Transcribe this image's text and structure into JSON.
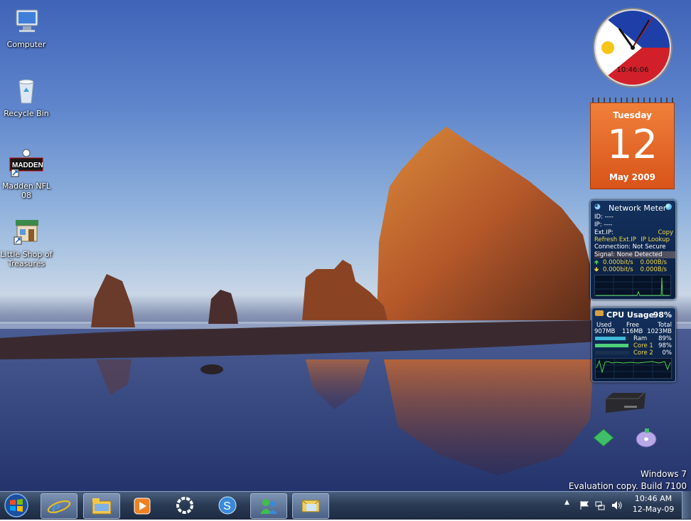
{
  "desktop_icons": [
    {
      "label": "Computer"
    },
    {
      "label": "Recycle Bin"
    },
    {
      "label": "Madden NFL 08",
      "art_text": "MADDEN"
    },
    {
      "label": "Little Shop of Treasures"
    }
  ],
  "watermark": {
    "line1": "Windows 7",
    "line2": "Evaluation copy. Build 7100"
  },
  "clock_gadget": {
    "time": "10:46:06"
  },
  "calendar_gadget": {
    "weekday": "Tuesday",
    "day": "12",
    "month_year": "May 2009"
  },
  "network_meter": {
    "title": "Network Meter",
    "id_label": "ID: ----",
    "ip_label": "IP: ----",
    "ext_ip_label": "Ext.IP:",
    "copy_link": "Copy",
    "refresh_link": "Refresh Ext.IP",
    "lookup_link": "IP Lookup",
    "connection": "Connection: Not Secure",
    "signal": "Signal: None Detected",
    "up_rate": "0.000bit/s",
    "up_bytes": "0.000B/s",
    "down_rate": "0.000bit/s",
    "down_bytes": "0.000B/s"
  },
  "cpu_gadget": {
    "title": "CPU Usage",
    "percent": "98%",
    "used_label": "Used",
    "free_label": "Free",
    "total_label": "Total",
    "used": "907MB",
    "free": "116MB",
    "total": "1023MB",
    "ram_label": "Ram",
    "ram_pct": "89%",
    "core1_label": "Core 1",
    "core1_pct": "98%",
    "core2_label": "Core 2",
    "core2_pct": "0%",
    "ram_level": 0.89,
    "core1_level": 0.98,
    "core2_level": 0.0
  },
  "taskbar": {
    "pinned": [
      "start-button",
      "internet-explorer",
      "windows-explorer",
      "media-player",
      "settings",
      "messenger",
      "windows-live-messenger",
      "mail"
    ],
    "clock_time": "10:46 AM",
    "clock_date": "12-May-09"
  }
}
